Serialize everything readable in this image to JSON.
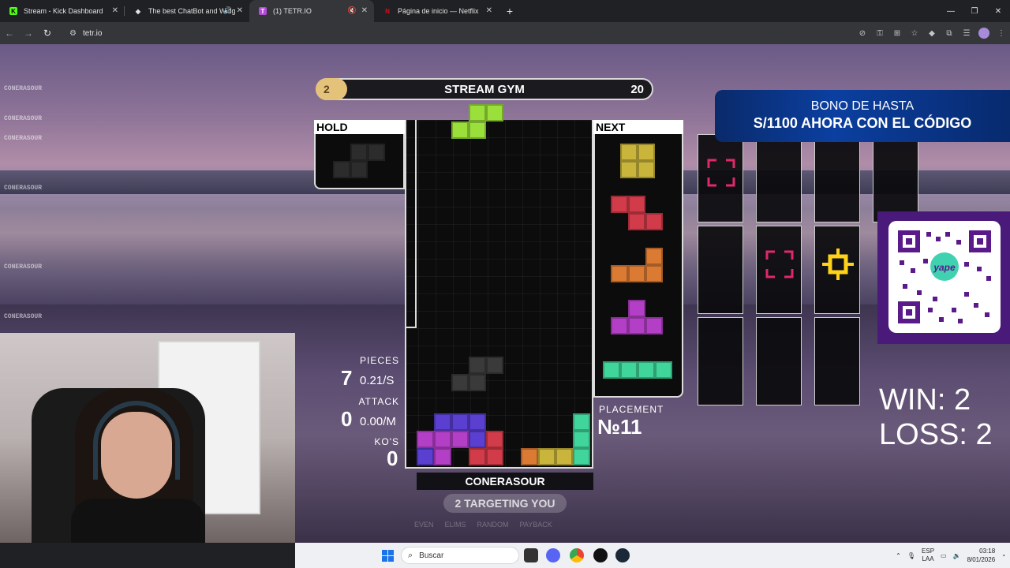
{
  "browser": {
    "tabs": [
      {
        "title": "Stream - Kick Dashboard",
        "favicon_color": "#53fc18",
        "favicon_letter": "K",
        "active": false
      },
      {
        "title": "The best ChatBot and Widg",
        "favicon_color": "#e3e3e3",
        "favicon_letter": "◆",
        "active": false
      },
      {
        "title": "(1) TETR.IO",
        "favicon_color": "#b44ad8",
        "favicon_letter": "T",
        "active": true
      },
      {
        "title": "Página de inicio — Netflix",
        "favicon_color": "#e50914",
        "favicon_letter": "N",
        "active": false
      }
    ],
    "new_tab_label": "+",
    "url": "tetr.io"
  },
  "chat_overlay": {
    "names": [
      "CONERASOUR",
      "CONERASOUR",
      "CONERASOUR",
      "CONERASOUR",
      "CONERASOUR",
      "CONERASOUR"
    ]
  },
  "game": {
    "room": {
      "left_value": "2",
      "title": "STREAM GYM",
      "right_value": "20"
    },
    "hold_label": "HOLD",
    "next_label": "NEXT",
    "stats": {
      "pieces_label": "PIECES",
      "pieces_value": "7",
      "pieces_rate": "0.21/S",
      "attack_label": "ATTACK",
      "attack_value": "0",
      "attack_rate": "0.00/M",
      "kos_label": "KO'S",
      "kos_value": "0"
    },
    "placement_label": "PLACEMENT",
    "placement_value": "№11",
    "player_name": "CONERASOUR",
    "targeting": "2 TARGETING YOU",
    "strategies": [
      "EVEN",
      "ELIMS",
      "RANDOM",
      "PAYBACK"
    ],
    "colors": {
      "T": "#b43fc7",
      "Z": "#d23b4a",
      "L": "#db7a32",
      "J": "#5a3fd0",
      "S": "#9be03a",
      "O": "#c9b53c",
      "I": "#40d59a",
      "garbage": "#3a3a3a"
    }
  },
  "promo": {
    "line1": "BONO DE HASTA",
    "line2": "S/1100 AHORA CON EL CÓDIGO"
  },
  "qr": {
    "brand": "yape"
  },
  "scoreboard": {
    "win": "WIN: 2",
    "loss": "LOSS: 2"
  },
  "taskbar": {
    "search_placeholder": "Buscar",
    "lang_line1": "ESP",
    "lang_line2": "LAA",
    "time": "03:18",
    "date": "8/01/2026"
  }
}
